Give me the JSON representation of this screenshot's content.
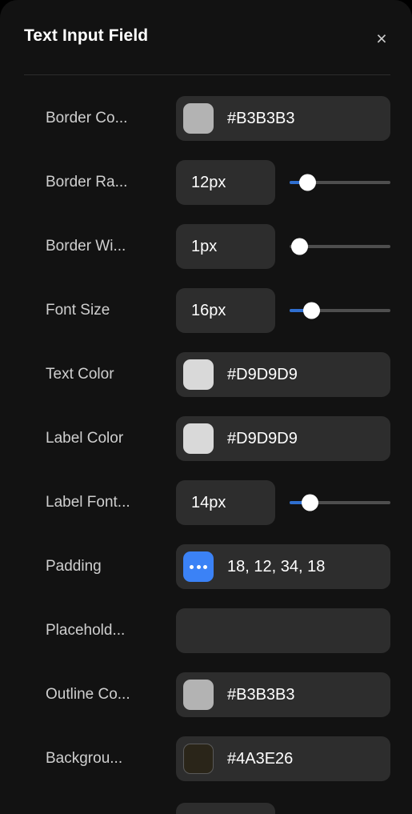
{
  "panel": {
    "title": "Text Input Field",
    "close_icon": "close-icon",
    "close_glyph": "×"
  },
  "colors": {
    "panel_background": "#121212",
    "field_background": "#2d2d2d",
    "accent": "#3B82F6",
    "slider_fill": "#2f6fd0",
    "label_text": "#cfcfcf",
    "value_text": "#ffffff"
  },
  "properties": [
    {
      "label": "Border Co...",
      "type": "color",
      "value": "#B3B3B3",
      "swatch_color": "#B3B3B3",
      "swatch_bordered": false
    },
    {
      "label": "Border Ra...",
      "type": "number",
      "value": "12px",
      "slider": {
        "fill_percent": 18,
        "thumb_percent": 18
      }
    },
    {
      "label": "Border Wi...",
      "type": "number",
      "value": "1px",
      "slider": {
        "fill_percent": 0,
        "thumb_percent": 10
      }
    },
    {
      "label": "Font Size",
      "type": "number",
      "value": "16px",
      "slider": {
        "fill_percent": 22,
        "thumb_percent": 22
      }
    },
    {
      "label": "Text Color",
      "type": "color",
      "value": "#D9D9D9",
      "swatch_color": "#D9D9D9",
      "swatch_bordered": false
    },
    {
      "label": "Label Color",
      "type": "color",
      "value": "#D9D9D9",
      "swatch_color": "#D9D9D9",
      "swatch_bordered": false
    },
    {
      "label": "Label Font...",
      "type": "number",
      "value": "14px",
      "slider": {
        "fill_percent": 20,
        "thumb_percent": 20
      }
    },
    {
      "label": "Padding",
      "type": "multi",
      "value": "18, 12, 34, 18",
      "swatch_color": "#3B82F6",
      "swatch_icon": "ellipsis-icon",
      "swatch_bordered": false
    },
    {
      "label": "Placehold...",
      "type": "text",
      "value": "",
      "placeholder": ""
    },
    {
      "label": "Outline Co...",
      "type": "color",
      "value": "#B3B3B3",
      "swatch_color": "#B3B3B3",
      "swatch_bordered": false
    },
    {
      "label": "Backgrou...",
      "type": "color",
      "value": "#4A3E26",
      "swatch_color": "#2a2519",
      "swatch_bordered": true
    }
  ]
}
